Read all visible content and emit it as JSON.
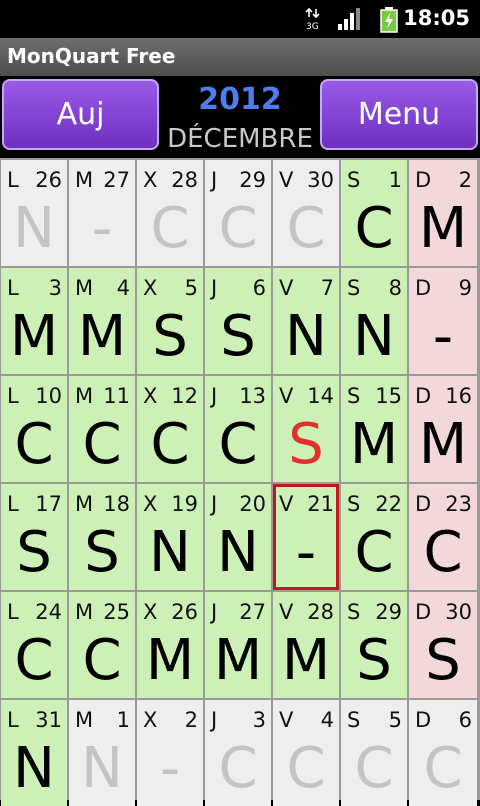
{
  "status_bar": {
    "time": "18:05",
    "network": "3G"
  },
  "app": {
    "title": "MonQuart Free"
  },
  "header": {
    "today_button": "Auj",
    "menu_button": "Menu",
    "year": "2012",
    "month": "DÉCEMBRE"
  },
  "calendar": {
    "weeks": [
      [
        {
          "day": "L",
          "num": "26",
          "code": "N",
          "style": "gray"
        },
        {
          "day": "M",
          "num": "27",
          "code": "-",
          "style": "gray"
        },
        {
          "day": "X",
          "num": "28",
          "code": "C",
          "style": "gray"
        },
        {
          "day": "J",
          "num": "29",
          "code": "C",
          "style": "gray"
        },
        {
          "day": "V",
          "num": "30",
          "code": "C",
          "style": "gray"
        },
        {
          "day": "S",
          "num": "1",
          "code": "C",
          "style": "green"
        },
        {
          "day": "D",
          "num": "2",
          "code": "M",
          "style": "pink"
        }
      ],
      [
        {
          "day": "L",
          "num": "3",
          "code": "M",
          "style": "green"
        },
        {
          "day": "M",
          "num": "4",
          "code": "M",
          "style": "green"
        },
        {
          "day": "X",
          "num": "5",
          "code": "S",
          "style": "green"
        },
        {
          "day": "J",
          "num": "6",
          "code": "S",
          "style": "green"
        },
        {
          "day": "V",
          "num": "7",
          "code": "N",
          "style": "green"
        },
        {
          "day": "S",
          "num": "8",
          "code": "N",
          "style": "green"
        },
        {
          "day": "D",
          "num": "9",
          "code": "-",
          "style": "pink"
        }
      ],
      [
        {
          "day": "L",
          "num": "10",
          "code": "C",
          "style": "green"
        },
        {
          "day": "M",
          "num": "11",
          "code": "C",
          "style": "green"
        },
        {
          "day": "X",
          "num": "12",
          "code": "C",
          "style": "green"
        },
        {
          "day": "J",
          "num": "13",
          "code": "C",
          "style": "green"
        },
        {
          "day": "V",
          "num": "14",
          "code": "S",
          "style": "green",
          "red": true
        },
        {
          "day": "S",
          "num": "15",
          "code": "M",
          "style": "green"
        },
        {
          "day": "D",
          "num": "16",
          "code": "M",
          "style": "pink"
        }
      ],
      [
        {
          "day": "L",
          "num": "17",
          "code": "S",
          "style": "green"
        },
        {
          "day": "M",
          "num": "18",
          "code": "S",
          "style": "green"
        },
        {
          "day": "X",
          "num": "19",
          "code": "N",
          "style": "green"
        },
        {
          "day": "J",
          "num": "20",
          "code": "N",
          "style": "green"
        },
        {
          "day": "V",
          "num": "21",
          "code": "-",
          "style": "green",
          "today": true
        },
        {
          "day": "S",
          "num": "22",
          "code": "C",
          "style": "green"
        },
        {
          "day": "D",
          "num": "23",
          "code": "C",
          "style": "pink"
        }
      ],
      [
        {
          "day": "L",
          "num": "24",
          "code": "C",
          "style": "green"
        },
        {
          "day": "M",
          "num": "25",
          "code": "C",
          "style": "green"
        },
        {
          "day": "X",
          "num": "26",
          "code": "M",
          "style": "green"
        },
        {
          "day": "J",
          "num": "27",
          "code": "M",
          "style": "green"
        },
        {
          "day": "V",
          "num": "28",
          "code": "M",
          "style": "green"
        },
        {
          "day": "S",
          "num": "29",
          "code": "S",
          "style": "green"
        },
        {
          "day": "D",
          "num": "30",
          "code": "S",
          "style": "pink"
        }
      ],
      [
        {
          "day": "L",
          "num": "31",
          "code": "N",
          "style": "green"
        },
        {
          "day": "M",
          "num": "1",
          "code": "N",
          "style": "gray"
        },
        {
          "day": "X",
          "num": "2",
          "code": "-",
          "style": "gray"
        },
        {
          "day": "J",
          "num": "3",
          "code": "C",
          "style": "gray"
        },
        {
          "day": "V",
          "num": "4",
          "code": "C",
          "style": "gray"
        },
        {
          "day": "S",
          "num": "5",
          "code": "C",
          "style": "gray"
        },
        {
          "day": "D",
          "num": "6",
          "code": "C",
          "style": "gray"
        }
      ]
    ]
  }
}
